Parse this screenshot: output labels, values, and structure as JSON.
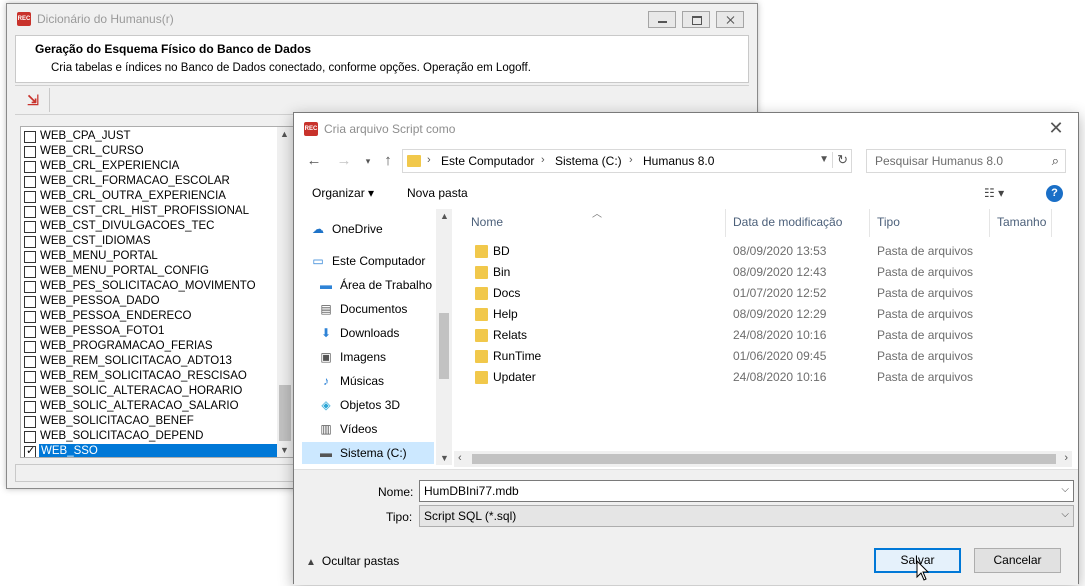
{
  "main_window": {
    "title": "Dicionário do Humanus(r)",
    "icon": "humanus-app-icon",
    "heading": "Geração do Esquema Físico do Banco de Dados",
    "description": "Cria tabelas e índices no Banco de Dados conectado, conforme opções. Operação em Logoff.",
    "toolbar_icon": "generate-icon",
    "tables": [
      {
        "name": "WEB_CPA_JUST",
        "checked": false
      },
      {
        "name": "WEB_CRL_CURSO",
        "checked": false
      },
      {
        "name": "WEB_CRL_EXPERIENCIA",
        "checked": false
      },
      {
        "name": "WEB_CRL_FORMACAO_ESCOLAR",
        "checked": false
      },
      {
        "name": "WEB_CRL_OUTRA_EXPERIENCIA",
        "checked": false
      },
      {
        "name": "WEB_CST_CRL_HIST_PROFISSIONAL",
        "checked": false
      },
      {
        "name": "WEB_CST_DIVULGACOES_TEC",
        "checked": false
      },
      {
        "name": "WEB_CST_IDIOMAS",
        "checked": false
      },
      {
        "name": "WEB_MENU_PORTAL",
        "checked": false
      },
      {
        "name": "WEB_MENU_PORTAL_CONFIG",
        "checked": false
      },
      {
        "name": "WEB_PES_SOLICITACAO_MOVIMENTO",
        "checked": false
      },
      {
        "name": "WEB_PESSOA_DADO",
        "checked": false
      },
      {
        "name": "WEB_PESSOA_ENDERECO",
        "checked": false
      },
      {
        "name": "WEB_PESSOA_FOTO1",
        "checked": false
      },
      {
        "name": "WEB_PROGRAMACAO_FERIAS",
        "checked": false
      },
      {
        "name": "WEB_REM_SOLICITACAO_ADTO13",
        "checked": false
      },
      {
        "name": "WEB_REM_SOLICITACAO_RESCISAO",
        "checked": false
      },
      {
        "name": "WEB_SOLIC_ALTERACAO_HORARIO",
        "checked": false
      },
      {
        "name": "WEB_SOLIC_ALTERACAO_SALARIO",
        "checked": false
      },
      {
        "name": "WEB_SOLICITACAO_BENEF",
        "checked": false
      },
      {
        "name": "WEB_SOLICITACAO_DEPEND",
        "checked": false
      },
      {
        "name": "WEB_SSO",
        "checked": true,
        "selected": true
      }
    ]
  },
  "dialog": {
    "title": "Cria arquivo Script como",
    "address": {
      "crumbs": [
        "Este Computador",
        "Sistema (C:)",
        "Humanus 8.0"
      ]
    },
    "search": {
      "placeholder": "Pesquisar Humanus 8.0"
    },
    "commands": {
      "organize": "Organizar ▾",
      "new_folder": "Nova pasta",
      "help": "?"
    },
    "nav_items": [
      {
        "label": "OneDrive",
        "icon": "cloud-icon"
      },
      {
        "label": "Este Computador",
        "icon": "computer-icon"
      },
      {
        "label": "Área de Trabalho",
        "icon": "desktop-icon"
      },
      {
        "label": "Documentos",
        "icon": "documents-icon"
      },
      {
        "label": "Downloads",
        "icon": "download-icon"
      },
      {
        "label": "Imagens",
        "icon": "pictures-icon"
      },
      {
        "label": "Músicas",
        "icon": "music-icon"
      },
      {
        "label": "Objetos 3D",
        "icon": "cube-icon"
      },
      {
        "label": "Vídeos",
        "icon": "video-icon"
      },
      {
        "label": "Sistema (C:)",
        "icon": "drive-icon",
        "selected": true
      }
    ],
    "columns": {
      "name": "Nome",
      "date": "Data de modificação",
      "type": "Tipo",
      "size": "Tamanho"
    },
    "files": [
      {
        "name": "BD",
        "date": "08/09/2020 13:53",
        "type": "Pasta de arquivos"
      },
      {
        "name": "Bin",
        "date": "08/09/2020 12:43",
        "type": "Pasta de arquivos"
      },
      {
        "name": "Docs",
        "date": "01/07/2020 12:52",
        "type": "Pasta de arquivos"
      },
      {
        "name": "Help",
        "date": "08/09/2020 12:29",
        "type": "Pasta de arquivos"
      },
      {
        "name": "Relats",
        "date": "24/08/2020 10:16",
        "type": "Pasta de arquivos"
      },
      {
        "name": "RunTime",
        "date": "01/06/2020 09:45",
        "type": "Pasta de arquivos"
      },
      {
        "name": "Updater",
        "date": "24/08/2020 10:16",
        "type": "Pasta de arquivos"
      }
    ],
    "filename_label": "Nome:",
    "filename_value": "HumDBIni77.mdb",
    "type_label": "Tipo:",
    "type_value": "Script SQL (*.sql)",
    "hide_folders": "Ocultar pastas",
    "save_label": "Salvar",
    "cancel_label": "Cancelar"
  }
}
